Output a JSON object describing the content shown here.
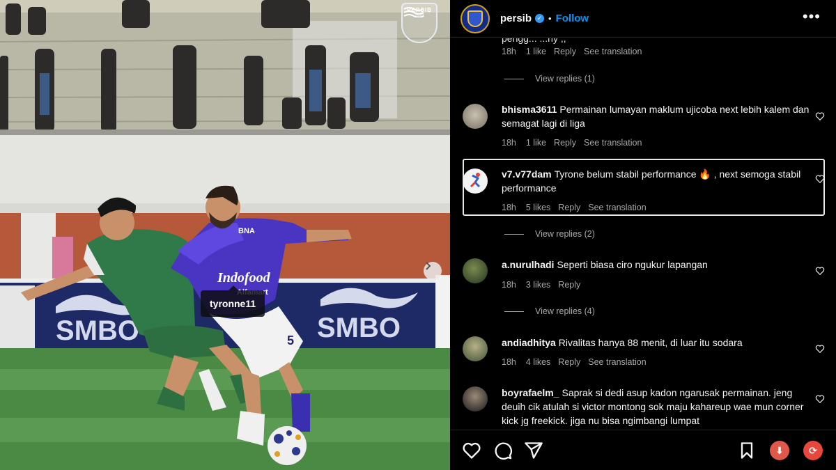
{
  "photo": {
    "logo_text": "PERSIB",
    "logo_year": "1933",
    "sponsor_board_1": "SMBO",
    "sponsor_board_2": "SMBO",
    "jersey_sponsor": "Indofood",
    "jersey_sponsor_2": "Alfamart",
    "jersey_logo": "BNA",
    "jersey_number": "5",
    "tag_username": "tyronne11",
    "next_icon": "chevron-right-icon"
  },
  "header": {
    "username": "persib",
    "verified_icon": "verified-badge-icon",
    "separator": "•",
    "follow_label": "Follow",
    "more_label": "•••"
  },
  "comments": {
    "partial_text": "pengg...                                                                          ...ny ,,",
    "top_meta": {
      "time": "18h",
      "likes": "1 like",
      "reply": "Reply",
      "translate": "See translation"
    },
    "view_replies_1": "View replies (1)",
    "items": [
      {
        "username": "bhisma3611",
        "text": "Permainan lumayan maklum ujicoba next lebih kalem dan semagat lagi di liga",
        "time": "18h",
        "likes": "1 like",
        "reply": "Reply",
        "translate": "See translation"
      },
      {
        "username": "v7.v77dam",
        "text": "Tyrone belum stabil performance 🔥 , next semoga stabil performance",
        "time": "18h",
        "likes": "5 likes",
        "reply": "Reply",
        "translate": "See translation"
      },
      {
        "username": "a.nurulhadi",
        "text": "Seperti biasa ciro ngukur lapangan",
        "time": "18h",
        "likes": "3 likes",
        "reply": "Reply",
        "translate": ""
      },
      {
        "username": "andiadhitya",
        "text": "Rivalitas hanya 88 menit, di luar itu sodara",
        "time": "18h",
        "likes": "4 likes",
        "reply": "Reply",
        "translate": "See translation"
      },
      {
        "username": "boyrafaelm_",
        "text": "Saprak si dedi asup kadon ngarusak permainan. jeng deuih cik atulah si victor montong sok maju kahareup wae mun corner kick jg freekick. jiga nu bisa ngimbangi lumpat",
        "time": "",
        "likes": "",
        "reply": "",
        "translate": ""
      }
    ],
    "view_replies_2": "View replies (2)",
    "view_replies_4": "View replies (4)"
  },
  "actions": {
    "like_icon": "heart-icon",
    "comment_icon": "comment-icon",
    "share_icon": "share-icon",
    "save_icon": "bookmark-icon",
    "download_symbol": "⬇",
    "refresh_symbol": "⟳"
  },
  "colors": {
    "background": "#000000",
    "link_blue": "#0095f6",
    "secondary_text": "#a8a8a8",
    "download_badge": "#e0584a",
    "refresh_badge": "#e8473b"
  }
}
